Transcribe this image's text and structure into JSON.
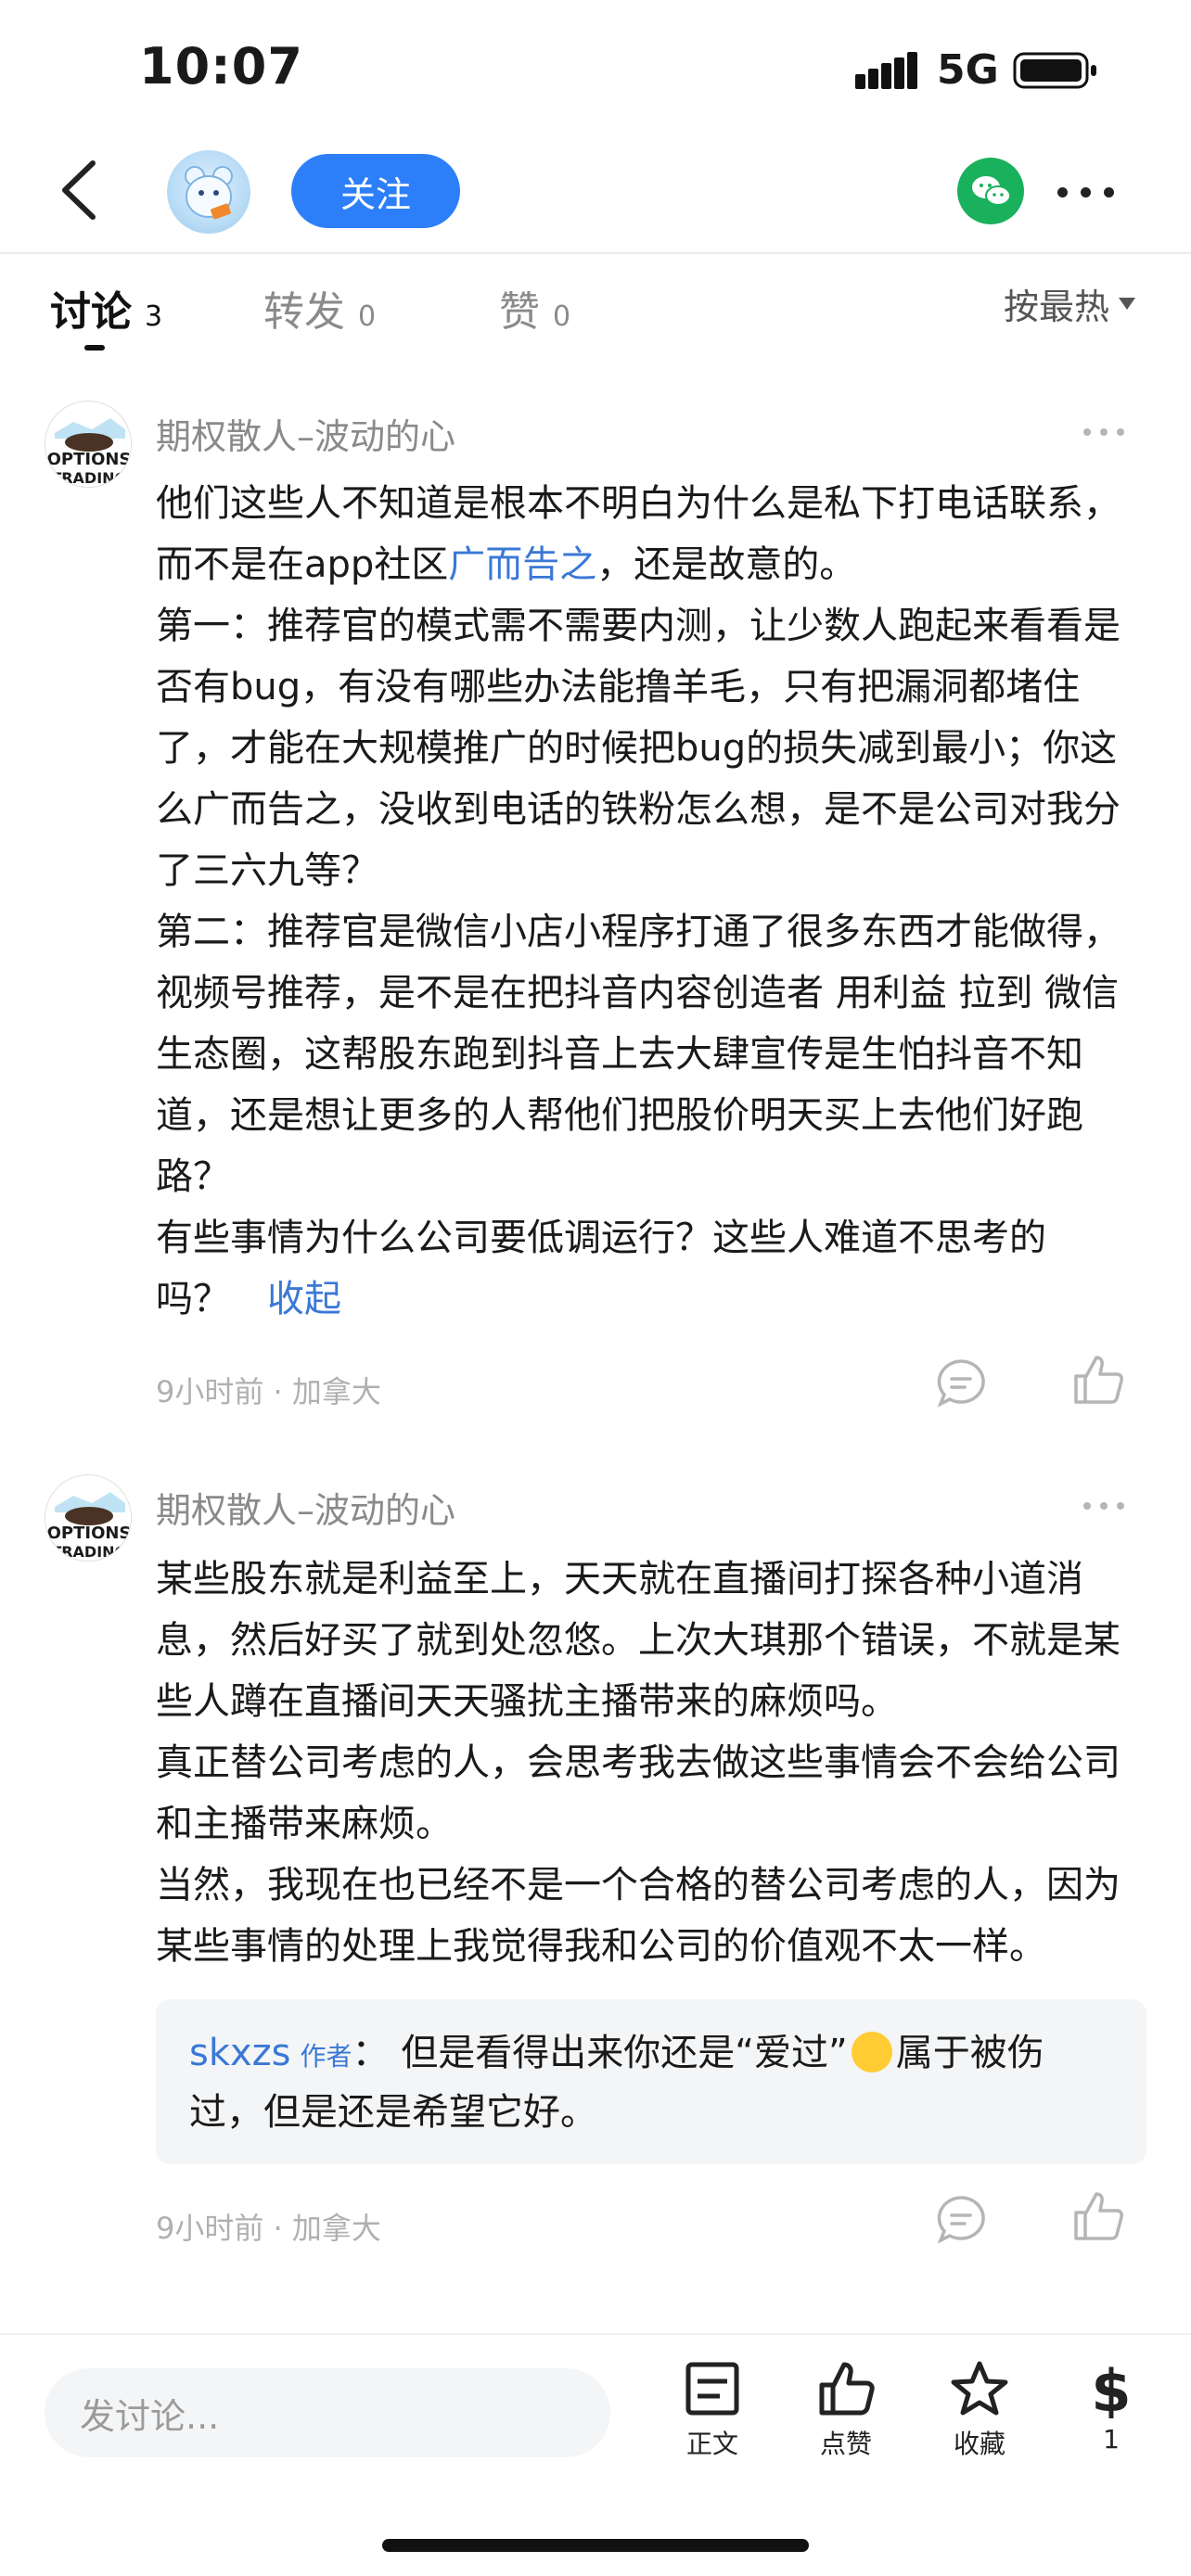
{
  "status_bar": {
    "time": "10:07",
    "network": "5G"
  },
  "nav": {
    "follow_label": "关注"
  },
  "tabs": [
    {
      "label": "讨论",
      "count": "3"
    },
    {
      "label": "转发",
      "count": "0"
    },
    {
      "label": "赞",
      "count": "0"
    }
  ],
  "sort_label": "按最热",
  "comments": [
    {
      "username": "期权散人–波动的心",
      "paragraphs": [
        {
          "pre": "他们这些人不知道是根本不明白为什么是私下打电话联系，而不是在app社区",
          "link": "广而告之",
          "post": "，还是故意的。"
        },
        "第一：推荐官的模式需不需要内测，让少数人跑起来看看是否有bug，有没有哪些办法能撸羊毛，只有把漏洞都堵住了，才能在大规模推广的时候把bug的损失减到最小；你这么广而告之，没收到电话的铁粉怎么想，是不是公司对我分了三六九等？",
        "第二：推荐官是微信小店小程序打通了很多东西才能做得，视频号推荐，是不是在把抖音内容创造者 用利益 拉到 微信生态圈，这帮股东跑到抖音上去大肆宣传是生怕抖音不知道，还是想让更多的人帮他们把股价明天买上去他们好跑路？",
        "有些事情为什么公司要低调运行？这些人难道不思考的吗？"
      ],
      "collapse_label": "收起",
      "time": "9小时前",
      "location": "加拿大"
    },
    {
      "username": "期权散人–波动的心",
      "paragraphs": [
        "某些股东就是利益至上，天天就在直播间打探各种小道消息，然后好买了就到处忽悠。上次大琪那个错误，不就是某些人蹲在直播间天天骚扰主播带来的麻烦吗。",
        "真正替公司考虑的人，会思考我去做这些事情会不会给公司和主播带来麻烦。",
        "当然，我现在也已经不是一个合格的替公司考虑的人，因为某些事情的处理上我觉得我和公司的价值观不太一样。"
      ],
      "reply": {
        "user": "skxzs",
        "tag": "作者",
        "sep": "：",
        "text_pre": "但是看得出来你还是“爱过”",
        "text_post": "属于被伤过，但是还是希望它好。"
      },
      "time": "9小时前",
      "location": "加拿大"
    }
  ],
  "bottom_bar": {
    "input_placeholder": "发讨论...",
    "items": [
      {
        "label": "正文",
        "icon": "document-icon"
      },
      {
        "label": "点赞",
        "icon": "thumbs-up-icon"
      },
      {
        "label": "收藏",
        "icon": "star-icon"
      },
      {
        "label": "1",
        "icon": "dollar-icon"
      }
    ]
  }
}
